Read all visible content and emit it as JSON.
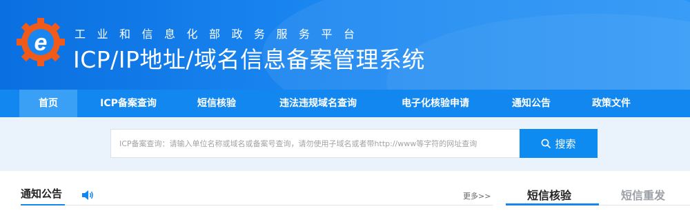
{
  "header": {
    "subtitle": "工业和信息化部政务服务平台",
    "title": "ICP/IP地址/域名信息备案管理系统",
    "logo_icon": "gear-e-logo-icon"
  },
  "nav": {
    "items": [
      {
        "label": "首页",
        "active": true
      },
      {
        "label": "ICP备案查询",
        "active": false
      },
      {
        "label": "短信核验",
        "active": false
      },
      {
        "label": "违法违规域名查询",
        "active": false
      },
      {
        "label": "电子化核验申请",
        "active": false
      },
      {
        "label": "通知公告",
        "active": false
      },
      {
        "label": "政策文件",
        "active": false
      }
    ]
  },
  "search": {
    "placeholder": "ICP备案查询：请输入单位名称或域名或备案号查询，请勿使用子域名或者带http://www等字符的网址查询",
    "button_label": "搜索",
    "button_icon": "search-icon"
  },
  "notice": {
    "tab_label": "通知公告",
    "speaker_icon": "speaker-icon",
    "more_label": "更多>>"
  },
  "sms_panel": {
    "tabs": [
      {
        "label": "短信核验",
        "active": true
      },
      {
        "label": "短信重发",
        "active": false
      }
    ]
  },
  "colors": {
    "header_blue": "#1a86f0",
    "nav_blue": "#1287ef",
    "nav_active": "#3aa0f5",
    "search_button": "#0d8bf0",
    "logo_orange": "#f05a1a"
  }
}
